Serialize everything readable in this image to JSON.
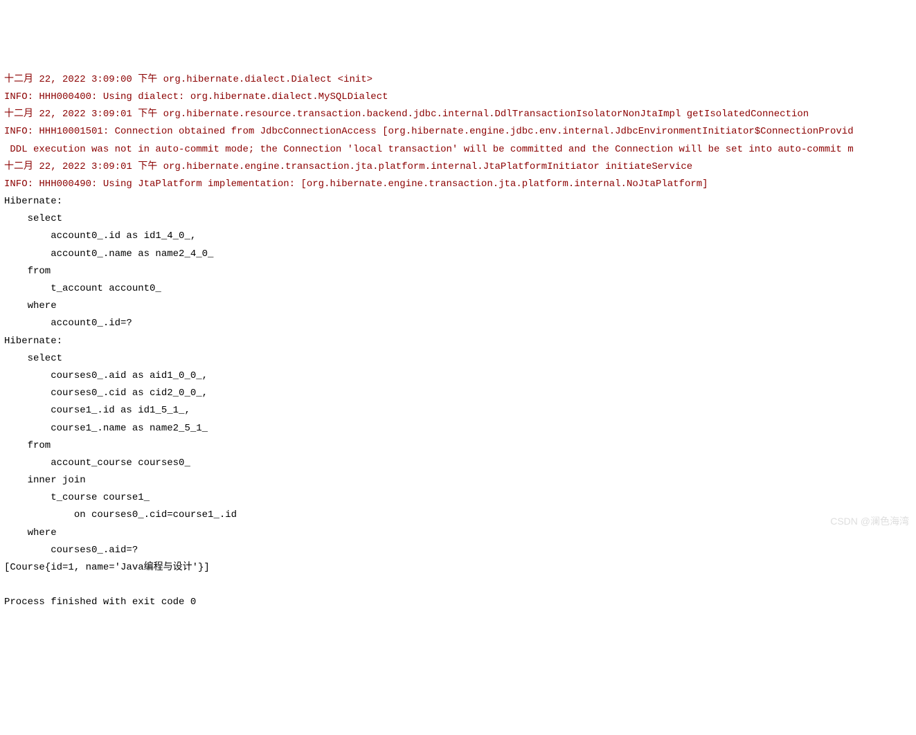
{
  "console": {
    "lines": [
      {
        "type": "log",
        "text": "十二月 22, 2022 3:09:00 下午 org.hibernate.dialect.Dialect <init>"
      },
      {
        "type": "log",
        "text": "INFO: HHH000400: Using dialect: org.hibernate.dialect.MySQLDialect"
      },
      {
        "type": "log",
        "text": "十二月 22, 2022 3:09:01 下午 org.hibernate.resource.transaction.backend.jdbc.internal.DdlTransactionIsolatorNonJtaImpl getIsolatedConnection"
      },
      {
        "type": "log",
        "text": "INFO: HHH10001501: Connection obtained from JdbcConnectionAccess [org.hibernate.engine.jdbc.env.internal.JdbcEnvironmentInitiator$ConnectionProvid"
      },
      {
        "type": "log",
        "text": " DDL execution was not in auto-commit mode; the Connection 'local transaction' will be committed and the Connection will be set into auto-commit m"
      },
      {
        "type": "log",
        "text": "十二月 22, 2022 3:09:01 下午 org.hibernate.engine.transaction.jta.platform.internal.JtaPlatformInitiator initiateService"
      },
      {
        "type": "log",
        "text": "INFO: HHH000490: Using JtaPlatform implementation: [org.hibernate.engine.transaction.jta.platform.internal.NoJtaPlatform]"
      },
      {
        "type": "sql",
        "text": "Hibernate: "
      },
      {
        "type": "sql",
        "text": "    select"
      },
      {
        "type": "sql",
        "text": "        account0_.id as id1_4_0_,"
      },
      {
        "type": "sql",
        "text": "        account0_.name as name2_4_0_ "
      },
      {
        "type": "sql",
        "text": "    from"
      },
      {
        "type": "sql",
        "text": "        t_account account0_ "
      },
      {
        "type": "sql",
        "text": "    where"
      },
      {
        "type": "sql",
        "text": "        account0_.id=?"
      },
      {
        "type": "sql",
        "text": "Hibernate: "
      },
      {
        "type": "sql",
        "text": "    select"
      },
      {
        "type": "sql",
        "text": "        courses0_.aid as aid1_0_0_,"
      },
      {
        "type": "sql",
        "text": "        courses0_.cid as cid2_0_0_,"
      },
      {
        "type": "sql",
        "text": "        course1_.id as id1_5_1_,"
      },
      {
        "type": "sql",
        "text": "        course1_.name as name2_5_1_ "
      },
      {
        "type": "sql",
        "text": "    from"
      },
      {
        "type": "sql",
        "text": "        account_course courses0_ "
      },
      {
        "type": "sql",
        "text": "    inner join"
      },
      {
        "type": "sql",
        "text": "        t_course course1_ "
      },
      {
        "type": "sql",
        "text": "            on courses0_.cid=course1_.id "
      },
      {
        "type": "sql",
        "text": "    where"
      },
      {
        "type": "sql",
        "text": "        courses0_.aid=?"
      },
      {
        "type": "result",
        "text": "[Course{id=1, name='Java编程与设计'}]"
      },
      {
        "type": "blank",
        "text": ""
      },
      {
        "type": "exit",
        "text": "Process finished with exit code 0"
      }
    ]
  },
  "watermark": "CSDN @澜色海湾"
}
